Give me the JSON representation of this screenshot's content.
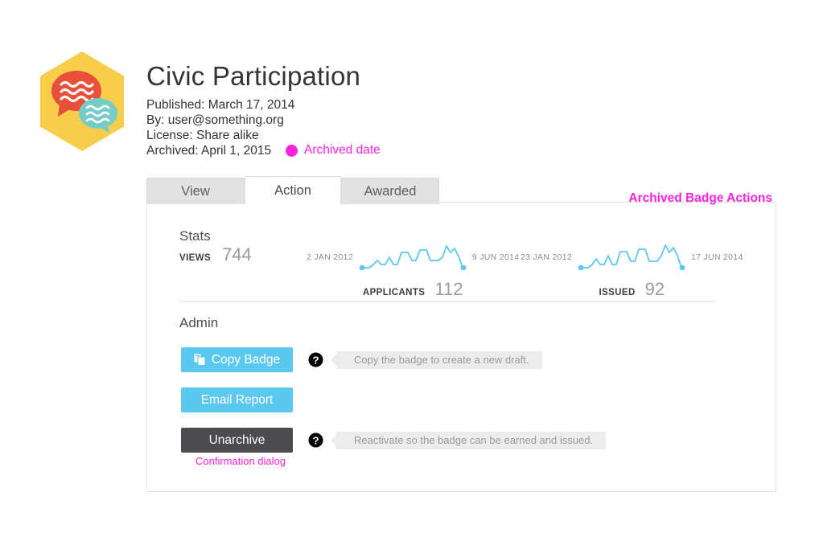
{
  "header": {
    "badge_title": "Civic Participation",
    "badge_icon": "speech-bubbles-hexagon-badge",
    "published": "Published: March 17, 2014",
    "by": "By: user@something.org",
    "license": "License: Share alike",
    "archived": "Archived: April 1, 2015",
    "archived_annotation": "Archived date",
    "annotation_color": "#ff22dd",
    "badge_colors": {
      "hexagon": "#f7ce4b",
      "bubble_primary": "#e8503a",
      "bubble_secondary": "#76cdc8"
    }
  },
  "tabs": {
    "items": [
      {
        "label": "View",
        "active": false
      },
      {
        "label": "Action",
        "active": true
      },
      {
        "label": "Awarded",
        "active": false
      }
    ],
    "page_annotation": "Archived Badge Actions"
  },
  "stats": {
    "heading": "Stats",
    "views": {
      "label": "VIEWS",
      "value": "744"
    },
    "applicants": {
      "label": "APPLICANTS",
      "value": "112",
      "start_date": "2 JAN 2012",
      "end_date": "9 JUN 2014"
    },
    "issued": {
      "label": "ISSUED",
      "value": "92",
      "start_date": "23 JAN 2012",
      "end_date": "17 JUN 2014"
    },
    "spark_color": "#5bc8f0"
  },
  "chart_data": [
    {
      "type": "line",
      "title": "APPLICANTS",
      "name": "applicants-sparkline",
      "xlabel": "",
      "ylabel": "",
      "x": [
        "2 JAN 2012",
        "9 JUN 2014"
      ],
      "values": [
        0,
        0,
        2,
        5,
        2,
        2,
        7,
        2,
        2,
        10,
        10,
        5,
        5,
        12,
        12,
        5,
        5,
        5,
        7,
        18,
        12,
        15,
        8,
        2,
        2,
        0
      ],
      "ylim": [
        0,
        20
      ],
      "grid": false,
      "legend": "none",
      "total": 112
    },
    {
      "type": "line",
      "title": "ISSUED",
      "name": "issued-sparkline",
      "xlabel": "",
      "ylabel": "",
      "x": [
        "23 JAN 2012",
        "17 JUN 2014"
      ],
      "values": [
        0,
        0,
        2,
        6,
        2,
        2,
        8,
        2,
        2,
        11,
        11,
        4,
        4,
        13,
        13,
        4,
        4,
        4,
        8,
        19,
        12,
        16,
        9,
        2,
        2,
        0
      ],
      "ylim": [
        0,
        20
      ],
      "grid": false,
      "legend": "none",
      "total": 92
    }
  ],
  "admin": {
    "heading": "Admin",
    "actions": [
      {
        "key": "copy",
        "label": "Copy Badge",
        "icon": "copy-icon",
        "style": "primary",
        "help_icon": "question-mark-icon",
        "tooltip": "Copy the badge to create a new draft.",
        "has_tooltip": true
      },
      {
        "key": "email",
        "label": "Email Report",
        "icon": "",
        "style": "primary",
        "help_icon": "",
        "tooltip": "",
        "has_tooltip": false
      },
      {
        "key": "unarchive",
        "label": "Unarchive",
        "icon": "",
        "style": "dark",
        "help_icon": "question-mark-icon",
        "tooltip": "Reactivate so the badge can be earned and issued.",
        "has_tooltip": true,
        "annotation": "Confirmation dialog"
      }
    ],
    "colors": {
      "primary_button": "#5bc8f0",
      "dark_button": "#4b4b50",
      "tooltip_bg": "#ececec"
    }
  }
}
